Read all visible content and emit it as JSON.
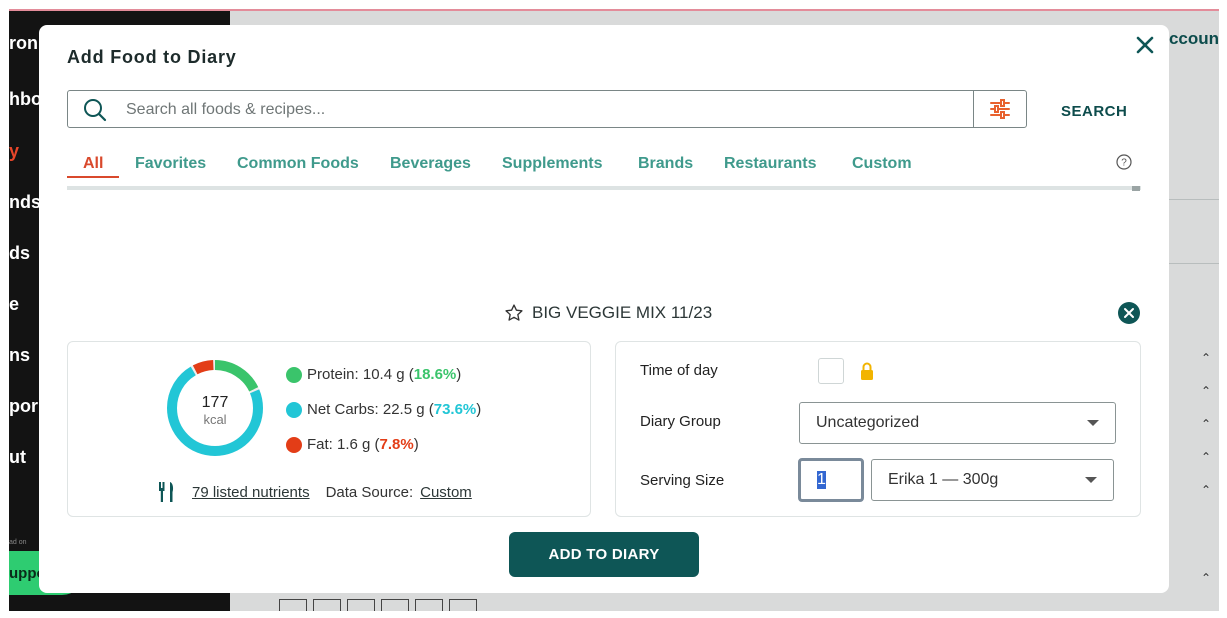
{
  "background": {
    "header_partial": "ccoun",
    "sidebar_partial_items": [
      "ron",
      "hbo",
      "y",
      "nds",
      "ds",
      "e",
      "ns",
      "por",
      "ut"
    ],
    "ad_text": "ad on",
    "support_label": "upport"
  },
  "modal": {
    "title": "Add Food to Diary",
    "search": {
      "placeholder": "Search all foods & recipes...",
      "value": "",
      "button_label": "SEARCH"
    },
    "tabs": [
      {
        "label": "All",
        "active": true
      },
      {
        "label": "Favorites",
        "active": false
      },
      {
        "label": "Common Foods",
        "active": false
      },
      {
        "label": "Beverages",
        "active": false
      },
      {
        "label": "Supplements",
        "active": false
      },
      {
        "label": "Brands",
        "active": false
      },
      {
        "label": "Restaurants",
        "active": false
      },
      {
        "label": "Custom",
        "active": false
      }
    ],
    "help_glyph": "?",
    "food": {
      "name": "BIG VEGGIE MIX 11/23",
      "favorite": false,
      "kcal": "177",
      "kcal_unit": "kcal",
      "macros": {
        "protein": {
          "label": "Protein: 10.4 g (",
          "pct": "18.6%",
          "close": ")",
          "color": "#3ac46b",
          "fraction": 0.186
        },
        "net_carbs": {
          "label": "Net Carbs: 22.5 g (",
          "pct": "73.6%",
          "close": ")",
          "color": "#22c6d6",
          "fraction": 0.736
        },
        "fat": {
          "label": "Fat: 1.6 g (",
          "pct": "7.8%",
          "close": ")",
          "color": "#e33d17",
          "fraction": 0.078
        }
      },
      "nutrients_link": "79 listed nutrients",
      "data_source_label": "Data Source:",
      "data_source_value": "Custom"
    },
    "form": {
      "time_of_day_label": "Time of day",
      "diary_group_label": "Diary Group",
      "diary_group_value": "Uncategorized",
      "serving_size_label": "Serving Size",
      "quantity": "1",
      "serving_unit": "Erika 1 — 300g"
    },
    "add_button_label": "ADD TO DIARY"
  },
  "colors": {
    "brand_dark": "#0e5656",
    "tab_text": "#3f9a8c",
    "tab_active": "#d9492c",
    "filter_icon": "#e8622f",
    "lock": "#f2b400"
  },
  "icons": [
    "close-icon",
    "search-icon",
    "filter-sliders-icon",
    "help-icon",
    "star-icon",
    "remove-icon",
    "fork-knife-icon",
    "lock-icon",
    "chevron-down-icon"
  ]
}
